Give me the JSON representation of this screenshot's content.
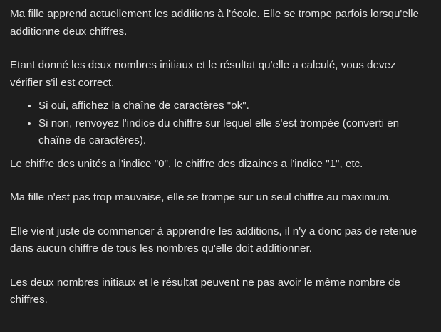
{
  "statement": {
    "paragraphs": {
      "p1": "Ma fille apprend actuellement les additions à l'école. Elle se trompe parfois lorsqu'elle additionne deux chiffres.",
      "p2": "Etant donné les deux nombres initiaux et le résultat qu'elle a calculé, vous devez vérifier s'il est correct.",
      "p3": "Le chiffre des unités a l'indice \"0\", le chiffre des dizaines a l'indice \"1\", etc.",
      "p4": "Ma fille n'est pas trop mauvaise, elle se trompe sur un seul chiffre au maximum.",
      "p5": "Elle vient juste de commencer à apprendre les additions, il n'y a donc pas de retenue dans aucun chiffre de tous les nombres qu'elle doit additionner.",
      "p6": "Les deux nombres initiaux et le résultat peuvent ne pas avoir le même nombre de chiffres."
    },
    "bullets": [
      "Si oui, affichez la chaîne de caractères \"ok\".",
      "Si non, renvoyez l'indice du chiffre sur lequel elle s'est trompée (converti en chaîne de caractères)."
    ],
    "colors": {
      "background": "#1e1e1e",
      "text": "#e3e3e3"
    }
  }
}
